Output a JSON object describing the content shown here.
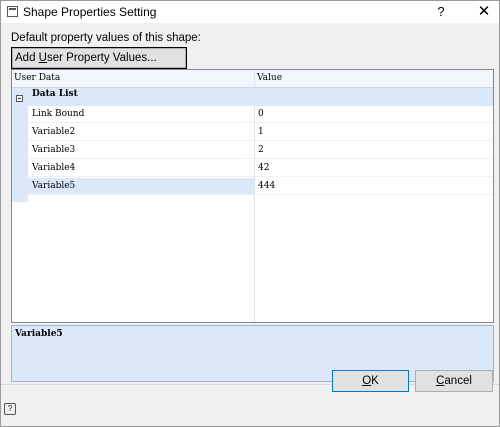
{
  "window": {
    "title": "Shape Properties Setting",
    "help_glyph": "?",
    "close_glyph": "✕"
  },
  "main": {
    "default_label": "Default property values of this shape:",
    "add_button": {
      "prefix": "Add ",
      "accel": "U",
      "suffix": "ser Property Values..."
    }
  },
  "grid": {
    "columns": [
      "User Data",
      "Value"
    ],
    "category": {
      "label": "Data List",
      "expanded": true
    },
    "rows": [
      {
        "name": "Link Bound",
        "value": "0"
      },
      {
        "name": "Variable2",
        "value": "1"
      },
      {
        "name": "Variable3",
        "value": "2"
      },
      {
        "name": "Variable4",
        "value": "42"
      },
      {
        "name": "Variable5",
        "value": "444"
      }
    ],
    "selected_row": "Variable5"
  },
  "description": {
    "title": "Variable5"
  },
  "footer": {
    "ok_accel": "O",
    "ok_rest": "K",
    "cancel_accel": "C",
    "cancel_rest": "ancel",
    "help_glyph": "?"
  },
  "colors": {
    "selection": "#dce8fa",
    "ok_border": "#0078d7"
  }
}
